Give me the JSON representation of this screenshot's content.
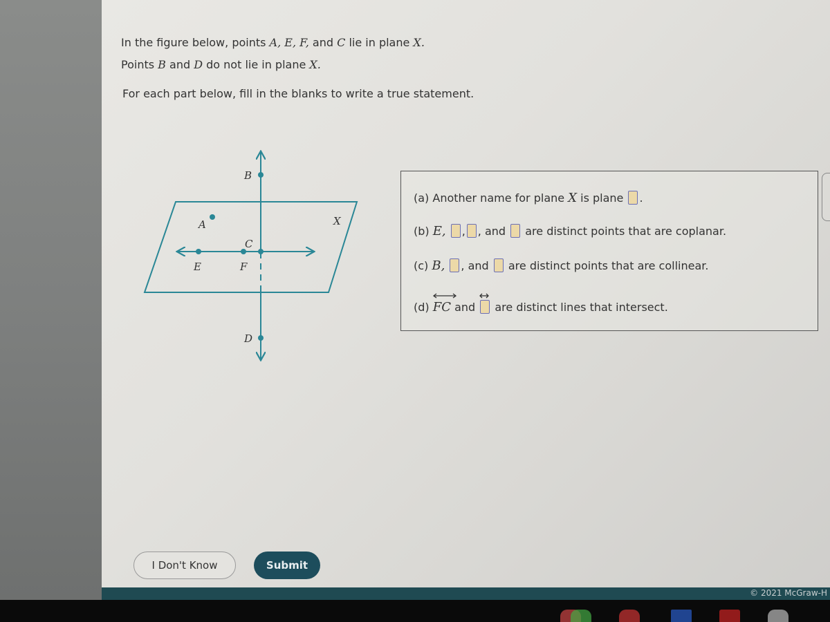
{
  "intro": {
    "line1_prefix": "In the figure below, points ",
    "line1_points": "A, E, F,",
    "line1_and": " and ",
    "line1_c": "C",
    "line1_suffix": " lie in plane ",
    "line1_plane": "X.",
    "line2_prefix": "Points ",
    "line2_b": "B",
    "line2_and": " and ",
    "line2_d": "D",
    "line2_suffix": " do not lie in plane ",
    "line2_plane": "X."
  },
  "instructions": "For each part below, fill in the blanks to write a true statement.",
  "figure": {
    "plane_label": "X",
    "points": {
      "A": "A",
      "B": "B",
      "C": "C",
      "D": "D",
      "E": "E",
      "F": "F"
    },
    "line_color": "#2a8796"
  },
  "questions": {
    "a": {
      "prefix": "(a) Another name for plane ",
      "var": "X",
      "mid": " is plane ",
      "suffix": "."
    },
    "b": {
      "prefix": "(b) ",
      "var": "E,",
      "and": ", and ",
      "suffix": " are distinct points that are coplanar."
    },
    "c": {
      "prefix": "(c) ",
      "var": "B,",
      "and": ", and ",
      "suffix": " are distinct points that are collinear."
    },
    "d": {
      "prefix": "(d) ",
      "var": "FC",
      "and": " and ",
      "suffix": " are distinct lines that intersect."
    }
  },
  "buttons": {
    "idk": "I Don't Know",
    "submit": "Submit"
  },
  "footer": {
    "copyright": "© 2021 McGraw-H"
  }
}
